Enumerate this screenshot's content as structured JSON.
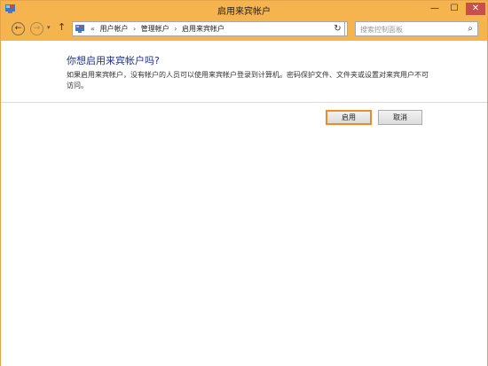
{
  "window": {
    "title": "启用来宾帐户",
    "minimize_glyph": "—",
    "maximize_glyph": "☐",
    "close_glyph": "✕"
  },
  "nav": {
    "back_glyph": "←",
    "forward_glyph": "→",
    "dropdown_glyph": "▾",
    "up_glyph": "↑"
  },
  "address": {
    "overflow": "«",
    "crumbs": [
      "用户帐户",
      "管理帐户",
      "启用来宾帐户"
    ],
    "separator": "›",
    "dropdown_glyph": "▾",
    "refresh_glyph": "↻"
  },
  "search": {
    "placeholder": "搜索控制面板",
    "icon_glyph": "⌕"
  },
  "main": {
    "heading": "你想启用来宾帐户吗?",
    "description": "如果启用来宾帐户，没有帐户的人员可以使用来宾帐户登录到计算机。密码保护文件、文件夹或设置对来宾用户不可访问。"
  },
  "actions": {
    "enable_label": "启用",
    "cancel_label": "取消"
  }
}
